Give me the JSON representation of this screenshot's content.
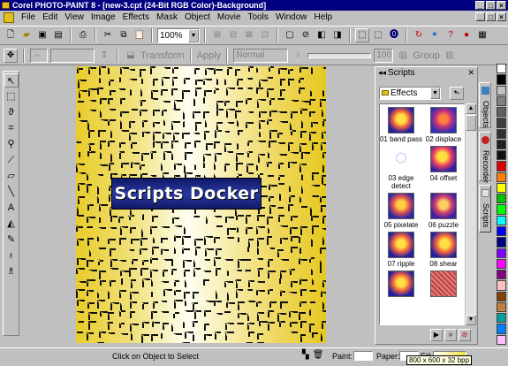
{
  "window": {
    "title": "Corel PHOTO-PAINT 8 - [new-3.cpt  (24-Bit RGB Color)-Background]",
    "controls": [
      "_",
      "□",
      "×"
    ]
  },
  "menu": [
    "File",
    "Edit",
    "View",
    "Image",
    "Effects",
    "Mask",
    "Object",
    "Movie",
    "Tools",
    "Window",
    "Help"
  ],
  "doc_controls": [
    "_",
    "□",
    "×"
  ],
  "toolbar": {
    "zoom": "100%"
  },
  "property_bar": {
    "transform_label": "Transform",
    "apply_label": "Apply",
    "merge_mode": "Normal",
    "opacity": "100",
    "group_label": "Group"
  },
  "canvas": {
    "banner_text": "Scripts Docker",
    "colors": {
      "left": "#e9cc2a",
      "center": "#fffff2",
      "right": "#e6c820",
      "tiles": "#101010"
    }
  },
  "docker": {
    "title": "Scripts",
    "folder": "Effects",
    "scripts": [
      {
        "label": "01 band pass",
        "icon": "balloon-thumbnail"
      },
      {
        "label": "02 displace",
        "icon": "balloon-thumbnail"
      },
      {
        "label": "03 edge detect",
        "icon": "balloon-outline-thumbnail"
      },
      {
        "label": "04 offset",
        "icon": "balloon-thumbnail"
      },
      {
        "label": "05 pixelate",
        "icon": "balloon-thumbnail"
      },
      {
        "label": "06 puzzle",
        "icon": "balloon-thumbnail"
      },
      {
        "label": "07 ripple",
        "icon": "balloon-thumbnail"
      },
      {
        "label": "08 shear",
        "icon": "balloon-thumbnail"
      },
      {
        "label": "",
        "icon": "balloon-thumbnail"
      },
      {
        "label": "",
        "icon": "texture-thumbnail"
      }
    ],
    "tabs": [
      "Objects",
      "Recorder",
      "Scripts"
    ]
  },
  "palette": [
    "#ffffff",
    "#000000",
    "#c0c0c0",
    "#808080",
    "#606060",
    "#404040",
    "#303030",
    "#202020",
    "#101010",
    "#e00000",
    "#ff8000",
    "#ffff00",
    "#00c000",
    "#00ff00",
    "#00ffff",
    "#0000ff",
    "#000080",
    "#8000ff",
    "#ff00ff",
    "#800080",
    "#ffc0c0",
    "#804000",
    "#c08040",
    "#00a0a0",
    "#0080ff",
    "#ffc0ff"
  ],
  "status": {
    "message": "Click on Object to Select",
    "paint_label": "Paint:",
    "paper_label": "Paper:",
    "fill_label": "Fill",
    "tooltip": "800 x 600 x 32 bpp"
  }
}
